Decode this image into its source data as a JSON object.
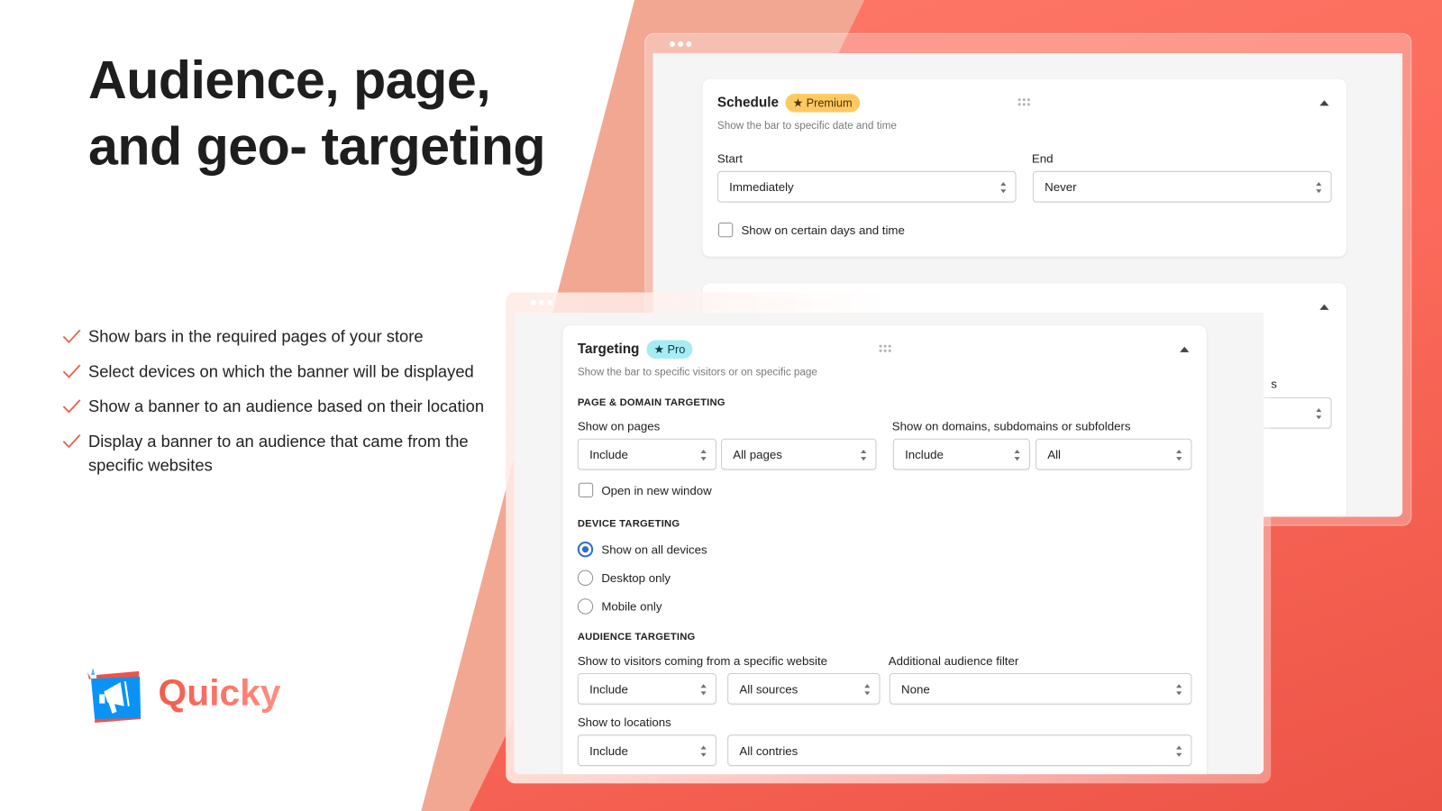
{
  "hero": {
    "title_line1": "Audience, page,",
    "title_line2": "and geo- targeting",
    "features": [
      "Show bars in the required pages of your store",
      "Select devices on which the banner will be displayed",
      "Show a banner to an audience based on their location",
      "Display a banner to an audience that came from the specific websites"
    ],
    "brand": "Quicky"
  },
  "colors": {
    "accent": "#f25a4a",
    "checkmark": "#f0604f",
    "premium_badge": "#ffc961",
    "pro_badge": "#a6ecf5",
    "radio_selected": "#2c6ecb"
  },
  "schedule": {
    "title": "Schedule",
    "badge": "Premium",
    "badge_icon": "star-icon",
    "subtitle": "Show the bar to specific date and time",
    "start_label": "Start",
    "start_value": "Immediately",
    "end_label": "End",
    "end_value": "Never",
    "checkbox_label": "Show on certain days and time",
    "checkbox_checked": false,
    "next_card_partial_label": "s"
  },
  "targeting": {
    "title": "Targeting",
    "badge": "Pro",
    "badge_icon": "star-icon",
    "subtitle": "Show the bar to specific visitors or on specific page",
    "page_domain": {
      "heading": "PAGE & DOMAIN TARGETING",
      "pages_label": "Show on pages",
      "pages_mode": "Include",
      "pages_value": "All pages",
      "domains_label": "Show on domains, subdomains or subfolders",
      "domains_mode": "Include",
      "domains_value": "All",
      "new_window_label": "Open in new window",
      "new_window_checked": false
    },
    "device": {
      "heading": "DEVICE TARGETING",
      "options": [
        "Show on all devices",
        "Desktop only",
        "Mobile only"
      ],
      "selected": "Show on all devices"
    },
    "audience": {
      "heading": "AUDIENCE TARGETING",
      "source_label": "Show to visitors coming from a specific website",
      "source_mode": "Include",
      "source_value": "All sources",
      "filter_label": "Additional audience filter",
      "filter_value": "None",
      "locations_label": "Show to locations",
      "locations_mode": "Include",
      "locations_value": "All contries"
    }
  }
}
